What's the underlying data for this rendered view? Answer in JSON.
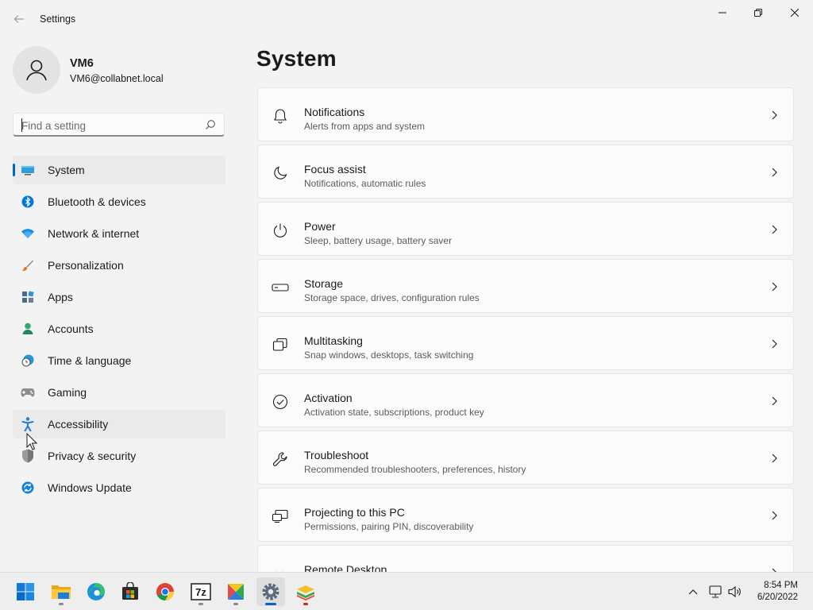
{
  "window": {
    "title": "Settings",
    "back_icon": "arrow-left-icon",
    "controls": [
      "minimize-icon",
      "maximize-icon",
      "close-icon"
    ]
  },
  "profile": {
    "name": "VM6",
    "email": "VM6@collabnet.local",
    "avatar_icon": "person-icon"
  },
  "search": {
    "placeholder": "Find a setting",
    "value": "",
    "icon": "search-icon"
  },
  "sidebar": {
    "selected": "System",
    "hovered": "Accessibility",
    "items": [
      {
        "label": "System",
        "icon": "monitor-icon"
      },
      {
        "label": "Bluetooth & devices",
        "icon": "bluetooth-icon"
      },
      {
        "label": "Network & internet",
        "icon": "wifi-icon"
      },
      {
        "label": "Personalization",
        "icon": "brush-icon"
      },
      {
        "label": "Apps",
        "icon": "apps-icon"
      },
      {
        "label": "Accounts",
        "icon": "account-icon"
      },
      {
        "label": "Time & language",
        "icon": "clock-globe-icon"
      },
      {
        "label": "Gaming",
        "icon": "gamepad-icon"
      },
      {
        "label": "Accessibility",
        "icon": "accessibility-icon"
      },
      {
        "label": "Privacy & security",
        "icon": "shield-icon"
      },
      {
        "label": "Windows Update",
        "icon": "update-icon"
      }
    ]
  },
  "main": {
    "title": "System",
    "cards": [
      {
        "title": "Notifications",
        "subtitle": "Alerts from apps and system",
        "icon": "bell-icon"
      },
      {
        "title": "Focus assist",
        "subtitle": "Notifications, automatic rules",
        "icon": "moon-icon"
      },
      {
        "title": "Power",
        "subtitle": "Sleep, battery usage, battery saver",
        "icon": "power-icon"
      },
      {
        "title": "Storage",
        "subtitle": "Storage space, drives, configuration rules",
        "icon": "drive-icon"
      },
      {
        "title": "Multitasking",
        "subtitle": "Snap windows, desktops, task switching",
        "icon": "multitask-icon"
      },
      {
        "title": "Activation",
        "subtitle": "Activation state, subscriptions, product key",
        "icon": "check-circle-icon"
      },
      {
        "title": "Troubleshoot",
        "subtitle": "Recommended troubleshooters, preferences, history",
        "icon": "wrench-icon"
      },
      {
        "title": "Projecting to this PC",
        "subtitle": "Permissions, pairing PIN, discoverability",
        "icon": "projector-icon"
      },
      {
        "title": "Remote Desktop",
        "subtitle": "",
        "icon": "remote-desktop-icon"
      }
    ]
  },
  "taskbar": {
    "apps": [
      {
        "name": "Start",
        "icon": "windows-start-icon"
      },
      {
        "name": "File Explorer",
        "icon": "folder-icon"
      },
      {
        "name": "Microsoft Edge",
        "icon": "edge-icon"
      },
      {
        "name": "Microsoft Store",
        "icon": "store-icon"
      },
      {
        "name": "Google Chrome",
        "icon": "chrome-icon"
      },
      {
        "name": "7-Zip",
        "icon": "7zip-icon"
      },
      {
        "name": "Colorful app",
        "icon": "colorful-app-icon"
      },
      {
        "name": "Settings",
        "icon": "settings-gear-icon"
      },
      {
        "name": "Stacked app",
        "icon": "stack-app-icon"
      }
    ],
    "tray_icons": [
      "chevron-up-icon",
      "network-icon",
      "volume-icon"
    ],
    "time": "8:54 PM",
    "date": "6/20/2022"
  },
  "colors": {
    "accent": "#0067c0",
    "background": "#f3f3f3",
    "card": "#fbfbfb"
  }
}
